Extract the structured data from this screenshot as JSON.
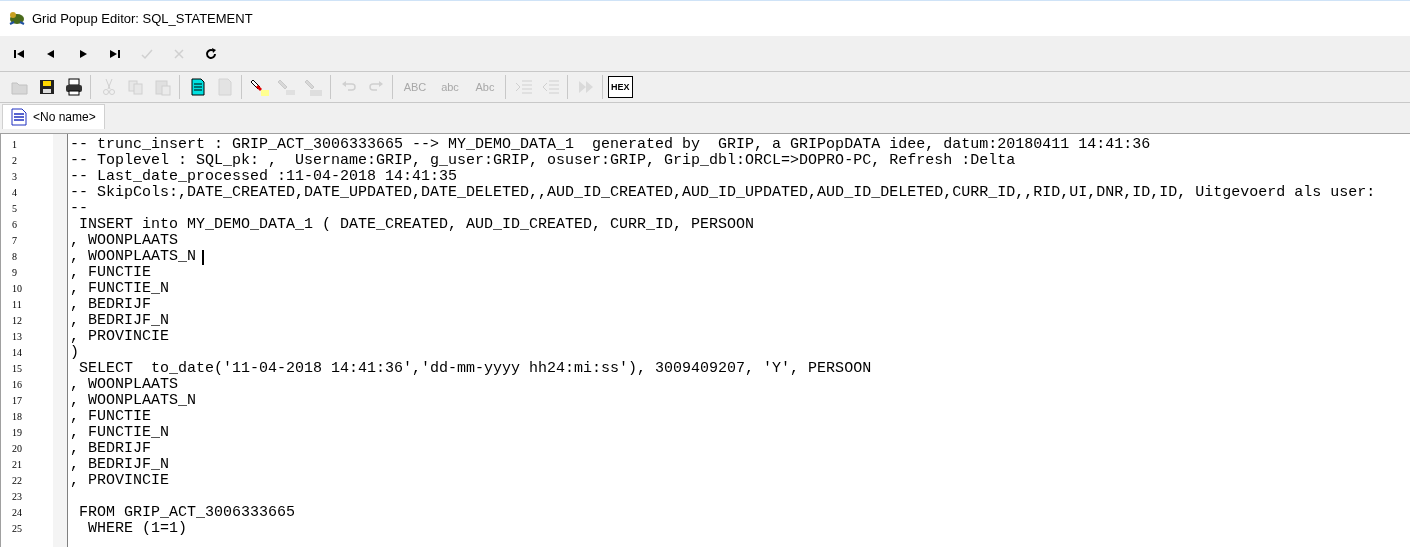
{
  "window": {
    "title": "Grid Popup Editor: SQL_STATEMENT"
  },
  "navigator": [
    {
      "kind": "first",
      "disabled": false
    },
    {
      "kind": "prior",
      "disabled": false
    },
    {
      "kind": "next",
      "disabled": false
    },
    {
      "kind": "last",
      "disabled": false
    },
    {
      "kind": "post",
      "disabled": true
    },
    {
      "kind": "cancel",
      "disabled": true
    },
    {
      "kind": "refresh",
      "disabled": false
    }
  ],
  "toolbar": [
    [
      {
        "kind": "open",
        "disabled": true
      },
      {
        "kind": "save",
        "disabled": false
      },
      {
        "kind": "print",
        "disabled": false
      }
    ],
    [
      {
        "kind": "cut",
        "disabled": true
      },
      {
        "kind": "copy",
        "disabled": true
      },
      {
        "kind": "paste",
        "disabled": true
      }
    ],
    [
      {
        "kind": "document",
        "disabled": false
      },
      {
        "kind": "blank",
        "disabled": true
      }
    ],
    [
      {
        "kind": "highlight",
        "disabled": false
      },
      {
        "kind": "find",
        "disabled": true
      },
      {
        "kind": "replace",
        "disabled": true
      }
    ],
    [
      {
        "kind": "undo",
        "disabled": true
      },
      {
        "kind": "redo",
        "disabled": true
      }
    ],
    [
      {
        "kind": "text",
        "label": "ABC",
        "disabled": true
      },
      {
        "kind": "text",
        "label": "abc",
        "disabled": true
      },
      {
        "kind": "text",
        "label": "Abc",
        "disabled": true
      }
    ],
    [
      {
        "kind": "indent",
        "disabled": true
      },
      {
        "kind": "outdent",
        "disabled": true
      }
    ],
    [
      {
        "kind": "play",
        "disabled": true
      }
    ],
    [
      {
        "kind": "hex",
        "label": "HEX",
        "disabled": false
      }
    ]
  ],
  "tabs": [
    {
      "label": "<No name>",
      "selected": true
    }
  ],
  "lines": [
    {
      "number": "1",
      "text": "-- trunc_insert : GRIP_ACT_3006333665 --> MY_DEMO_DATA_1  generated by  GRIP, a GRIPopDATA idee, datum:20180411 14:41:36",
      "cursor": false
    },
    {
      "number": "2",
      "text": "-- Toplevel : SQL_pk: ,  Username:GRIP, g_user:GRIP, osuser:GRIP, Grip_dbl:ORCL=>DOPRO-PC, Refresh :Delta",
      "cursor": false
    },
    {
      "number": "3",
      "text": "-- Last_date_processed :11-04-2018 14:41:35",
      "cursor": false
    },
    {
      "number": "4",
      "text": "-- SkipCols:,DATE_CREATED,DATE_UPDATED,DATE_DELETED,,AUD_ID_CREATED,AUD_ID_UPDATED,AUD_ID_DELETED,CURR_ID,,RID,UI,DNR,ID,ID, Uitgevoerd als user:",
      "cursor": false
    },
    {
      "number": "5",
      "text": "--",
      "cursor": false
    },
    {
      "number": "6",
      "text": " INSERT into MY_DEMO_DATA_1 ( DATE_CREATED, AUD_ID_CREATED, CURR_ID, PERSOON",
      "cursor": false
    },
    {
      "number": "7",
      "text": ", WOONPLAATS",
      "cursor": false
    },
    {
      "number": "8",
      "text": ", WOONPLAATS_N",
      "cursor": true
    },
    {
      "number": "9",
      "text": ", FUNCTIE",
      "cursor": false
    },
    {
      "number": "10",
      "text": ", FUNCTIE_N",
      "cursor": false
    },
    {
      "number": "11",
      "text": ", BEDRIJF",
      "cursor": false
    },
    {
      "number": "12",
      "text": ", BEDRIJF_N",
      "cursor": false
    },
    {
      "number": "13",
      "text": ", PROVINCIE",
      "cursor": false
    },
    {
      "number": "14",
      "text": ")",
      "cursor": false
    },
    {
      "number": "15",
      "text": " SELECT  to_date('11-04-2018 14:41:36','dd-mm-yyyy hh24:mi:ss'), 3009409207, 'Y', PERSOON",
      "cursor": false
    },
    {
      "number": "16",
      "text": ", WOONPLAATS",
      "cursor": false
    },
    {
      "number": "17",
      "text": ", WOONPLAATS_N",
      "cursor": false
    },
    {
      "number": "18",
      "text": ", FUNCTIE",
      "cursor": false
    },
    {
      "number": "19",
      "text": ", FUNCTIE_N",
      "cursor": false
    },
    {
      "number": "20",
      "text": ", BEDRIJF",
      "cursor": false
    },
    {
      "number": "21",
      "text": ", BEDRIJF_N",
      "cursor": false
    },
    {
      "number": "22",
      "text": ", PROVINCIE",
      "cursor": false
    },
    {
      "number": "23",
      "cursor": false
    },
    {
      "number": "24",
      "text": " FROM GRIP_ACT_3006333665",
      "cursor": false
    },
    {
      "number": "25",
      "text": "  WHERE (1=1)",
      "cursor": false
    }
  ]
}
